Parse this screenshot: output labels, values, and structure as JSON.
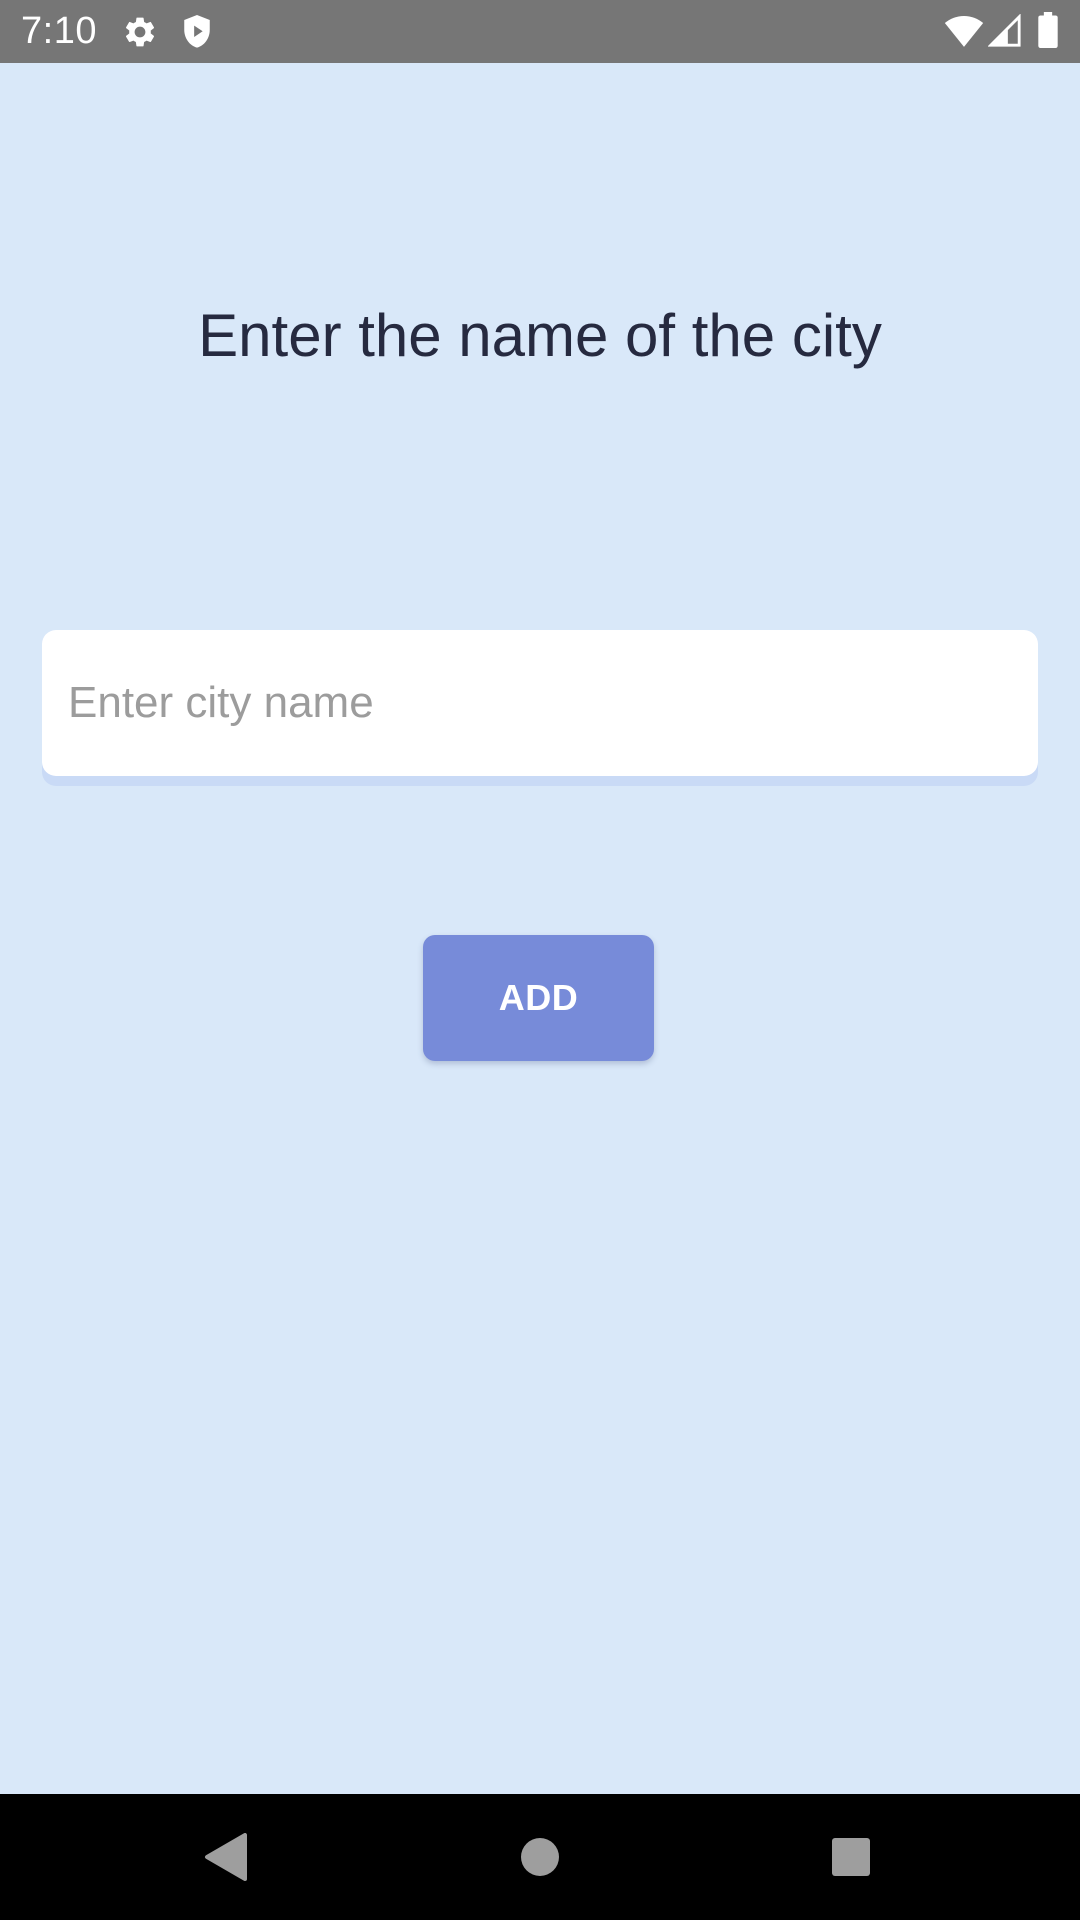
{
  "status_bar": {
    "time": "7:10",
    "icons": [
      "gear-icon",
      "shield-play-icon",
      "wifi-icon",
      "signal-icon",
      "battery-icon"
    ],
    "background": "#767676"
  },
  "main": {
    "title": "Enter the name of the city",
    "city_input": {
      "value": "",
      "placeholder": "Enter city name"
    },
    "add_button_label": "ADD"
  },
  "nav_bar": {
    "buttons": [
      "back-icon",
      "home-icon",
      "recents-icon"
    ]
  },
  "colors": {
    "background": "#d9e8f9",
    "title_text": "#262a40",
    "button": "#778bd9",
    "button_text": "#ffffff",
    "input_background": "#ffffff",
    "placeholder": "#9c9c9c"
  }
}
